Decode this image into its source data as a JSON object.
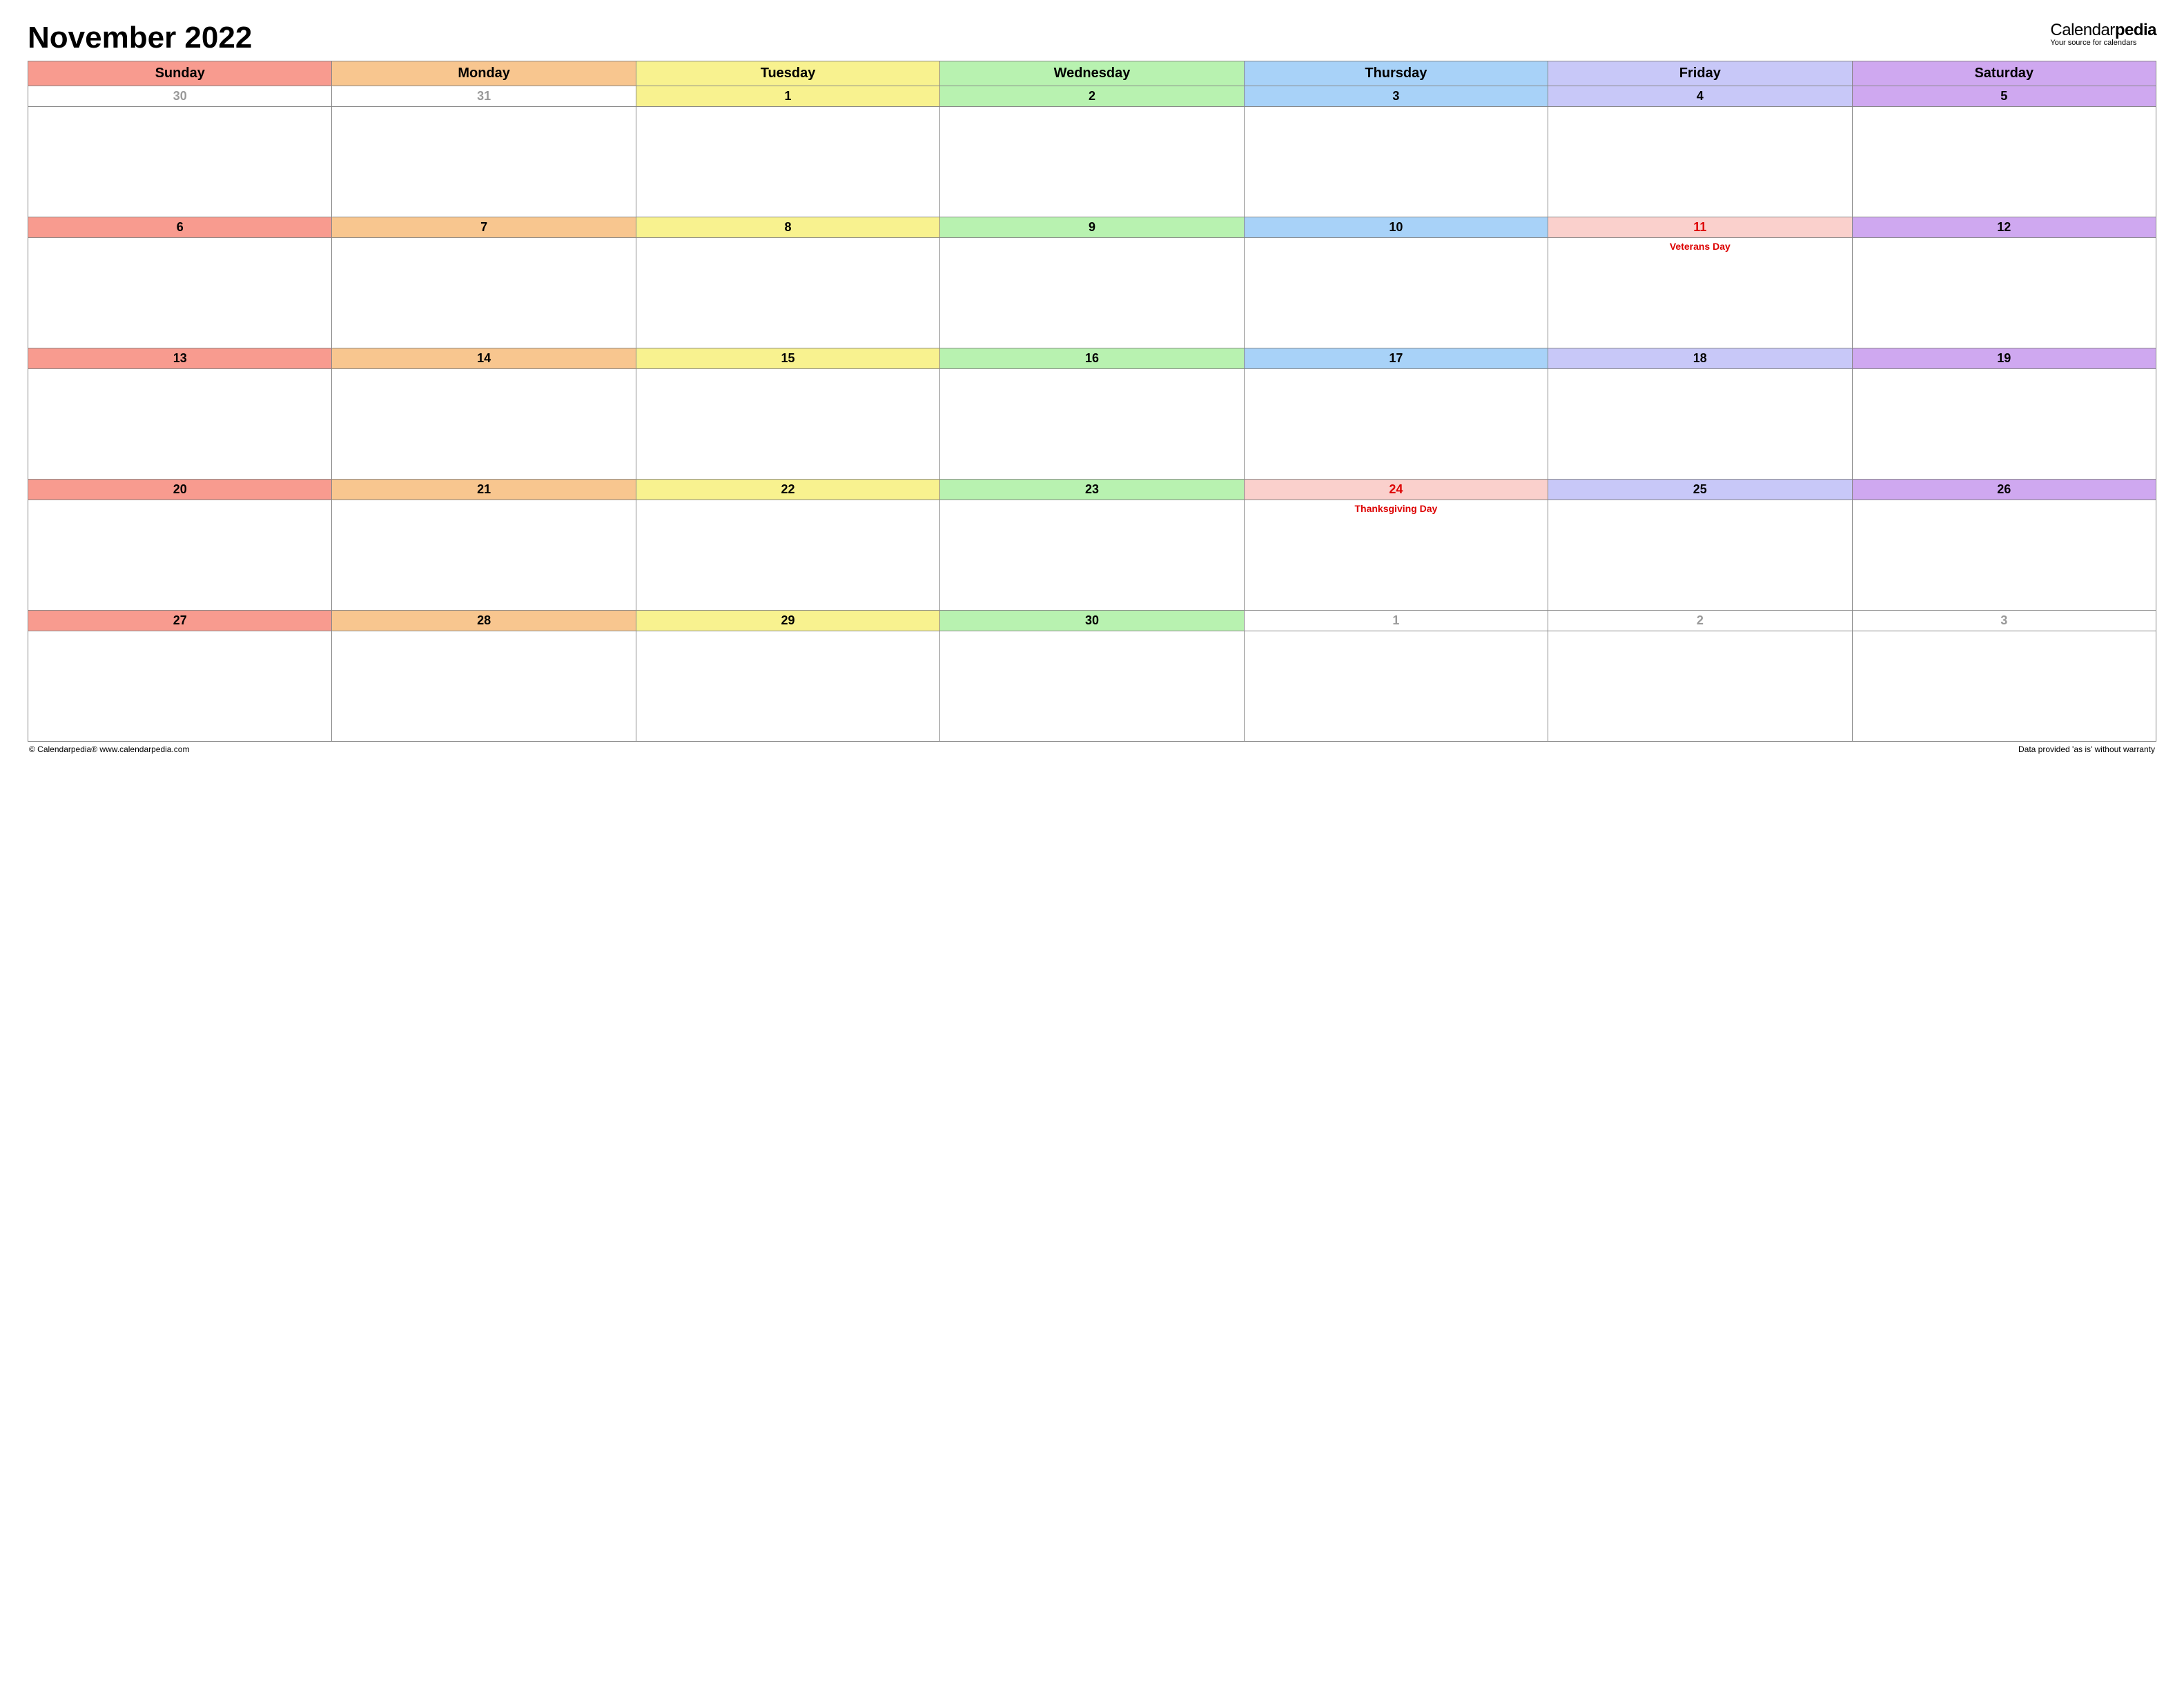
{
  "title": "November 2022",
  "brand": {
    "part1": "Calendar",
    "part2": "pedia",
    "tagline": "Your source for calendars"
  },
  "days": [
    "Sunday",
    "Monday",
    "Tuesday",
    "Wednesday",
    "Thursday",
    "Friday",
    "Saturday"
  ],
  "weeks": [
    {
      "nums": [
        {
          "n": "30",
          "out": true
        },
        {
          "n": "31",
          "out": true
        },
        {
          "n": "1"
        },
        {
          "n": "2"
        },
        {
          "n": "3"
        },
        {
          "n": "4"
        },
        {
          "n": "5"
        }
      ],
      "events": [
        "",
        "",
        "",
        "",
        "",
        "",
        ""
      ]
    },
    {
      "nums": [
        {
          "n": "6"
        },
        {
          "n": "7"
        },
        {
          "n": "8"
        },
        {
          "n": "9"
        },
        {
          "n": "10"
        },
        {
          "n": "11",
          "hol": true
        },
        {
          "n": "12"
        }
      ],
      "events": [
        "",
        "",
        "",
        "",
        "",
        "Veterans Day",
        ""
      ]
    },
    {
      "nums": [
        {
          "n": "13"
        },
        {
          "n": "14"
        },
        {
          "n": "15"
        },
        {
          "n": "16"
        },
        {
          "n": "17"
        },
        {
          "n": "18"
        },
        {
          "n": "19"
        }
      ],
      "events": [
        "",
        "",
        "",
        "",
        "",
        "",
        ""
      ]
    },
    {
      "nums": [
        {
          "n": "20"
        },
        {
          "n": "21"
        },
        {
          "n": "22"
        },
        {
          "n": "23"
        },
        {
          "n": "24",
          "hol": true
        },
        {
          "n": "25"
        },
        {
          "n": "26"
        }
      ],
      "events": [
        "",
        "",
        "",
        "",
        "Thanksgiving Day",
        "",
        ""
      ]
    },
    {
      "nums": [
        {
          "n": "27"
        },
        {
          "n": "28"
        },
        {
          "n": "29"
        },
        {
          "n": "30"
        },
        {
          "n": "1",
          "out": true
        },
        {
          "n": "2",
          "out": true
        },
        {
          "n": "3",
          "out": true
        }
      ],
      "events": [
        "",
        "",
        "",
        "",
        "",
        "",
        ""
      ]
    }
  ],
  "footer": {
    "left": "© Calendarpedia®   www.calendarpedia.com",
    "right": "Data provided 'as is' without warranty"
  }
}
